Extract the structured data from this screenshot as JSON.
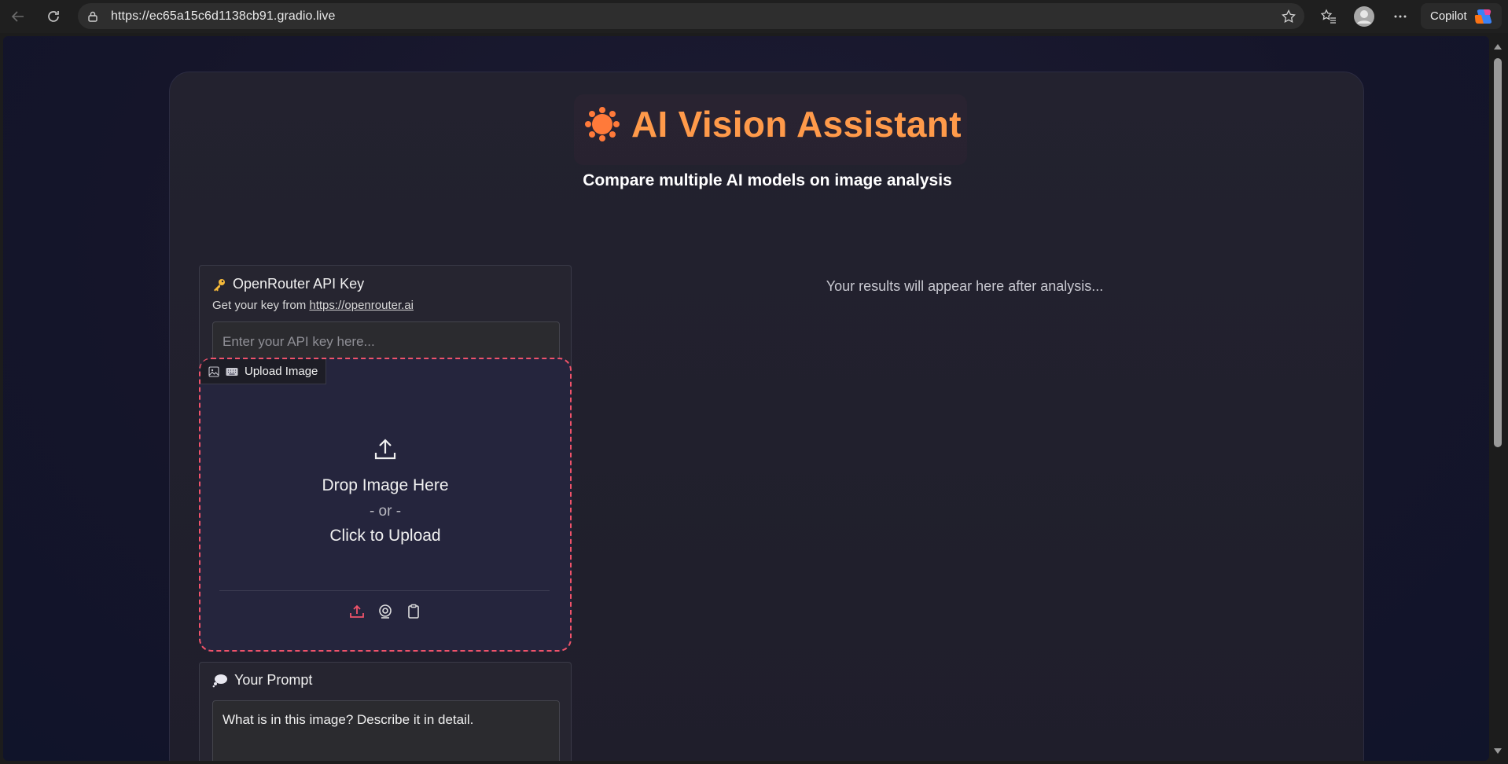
{
  "browser": {
    "url": "https://ec65a15c6d1138cb91.gradio.live",
    "copilot_label": "Copilot"
  },
  "app": {
    "title_emoji": "✹",
    "title": "AI Vision Assistant",
    "subtitle": "Compare multiple AI models on image analysis",
    "accent_color": "#ff9a4a"
  },
  "api_key": {
    "label": "OpenRouter API Key",
    "help_prefix": "Get your key from",
    "help_link": "https://openrouter.ai",
    "placeholder": "Enter your API key here...",
    "value": ""
  },
  "upload": {
    "label": "Upload Image",
    "drop_text": "Drop Image Here",
    "or_text": "- or -",
    "click_text": "Click to Upload",
    "border_color": "#f0536a"
  },
  "prompt": {
    "label": "Your Prompt",
    "value": "What is in this image? Describe it in detail."
  },
  "results": {
    "placeholder": "Your results will appear here after analysis..."
  }
}
